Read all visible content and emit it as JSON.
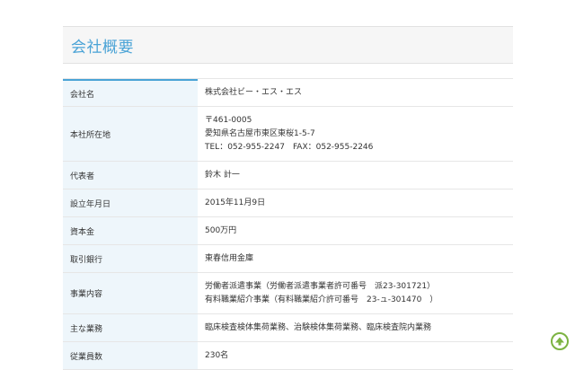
{
  "section": {
    "title": "会社概要"
  },
  "company_table": {
    "rows": [
      {
        "label": "会社名",
        "value": [
          "株式会社ビー・エス・エス"
        ]
      },
      {
        "label": "本社所在地",
        "value": [
          "〒461-0005",
          "愛知県名古屋市東区東桜1-5-7",
          "TEL：052-955-2247　FAX：052-955-2246"
        ]
      },
      {
        "label": "代表者",
        "value": [
          "鈴木 計一"
        ]
      },
      {
        "label": "設立年月日",
        "value": [
          "2015年11月9日"
        ]
      },
      {
        "label": "資本金",
        "value": [
          "500万円"
        ]
      },
      {
        "label": "取引銀行",
        "value": [
          "東春信用金庫"
        ]
      },
      {
        "label": "事業内容",
        "value": [
          "労働者派遣事業（労働者派遣事業者許可番号　派23-301721）",
          "有料職業紹介事業（有料職業紹介許可番号　23-ュ-301470　）"
        ]
      },
      {
        "label": "主な業務",
        "value": [
          "臨床検査検体集荷業務、治験検体集荷業務、臨床検査院内業務"
        ]
      },
      {
        "label": "従業員数",
        "value": [
          "230名"
        ]
      }
    ]
  },
  "scroll_top": {
    "icon": "arrow-up-circle-icon",
    "color": "#7cb342"
  }
}
